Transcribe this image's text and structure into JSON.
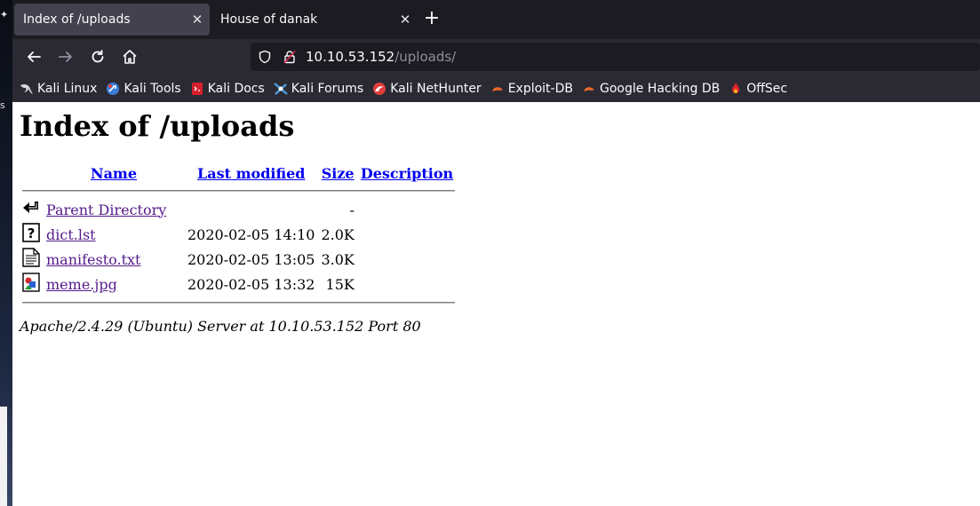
{
  "tabs": [
    {
      "title": "Index of /uploads",
      "active": true
    },
    {
      "title": "House of danak",
      "active": false
    }
  ],
  "new_tab_label": "+",
  "close_label": "✕",
  "url": {
    "host": "10.10.53.152",
    "path": "/uploads/"
  },
  "bookmarks": [
    {
      "label": "Kali Linux",
      "icon": "kali-dragon-icon"
    },
    {
      "label": "Kali Tools",
      "icon": "kali-tools-icon"
    },
    {
      "label": "Kali Docs",
      "icon": "kali-docs-icon"
    },
    {
      "label": "Kali Forums",
      "icon": "kali-forums-icon"
    },
    {
      "label": "Kali NetHunter",
      "icon": "kali-nethunter-icon"
    },
    {
      "label": "Exploit-DB",
      "icon": "exploit-db-icon"
    },
    {
      "label": "Google Hacking DB",
      "icon": "google-hacking-db-icon"
    },
    {
      "label": "OffSec",
      "icon": "offsec-icon"
    }
  ],
  "page": {
    "heading": "Index of /uploads",
    "columns": {
      "name": "Name",
      "modified": "Last modified",
      "size": "Size",
      "description": "Description"
    },
    "rows": [
      {
        "icon": "back-arrow-icon",
        "name": "Parent Directory",
        "modified": "",
        "size": "-",
        "description": ""
      },
      {
        "icon": "unknown-file-icon",
        "name": "dict.lst",
        "modified": "2020-02-05 14:10",
        "size": "2.0K",
        "description": ""
      },
      {
        "icon": "text-file-icon",
        "name": "manifesto.txt",
        "modified": "2020-02-05 13:05",
        "size": "3.0K",
        "description": ""
      },
      {
        "icon": "image-file-icon",
        "name": "meme.jpg",
        "modified": "2020-02-05 13:32",
        "size": "15K",
        "description": ""
      }
    ],
    "footer": "Apache/2.4.29 (Ubuntu) Server at 10.10.53.152 Port 80"
  }
}
